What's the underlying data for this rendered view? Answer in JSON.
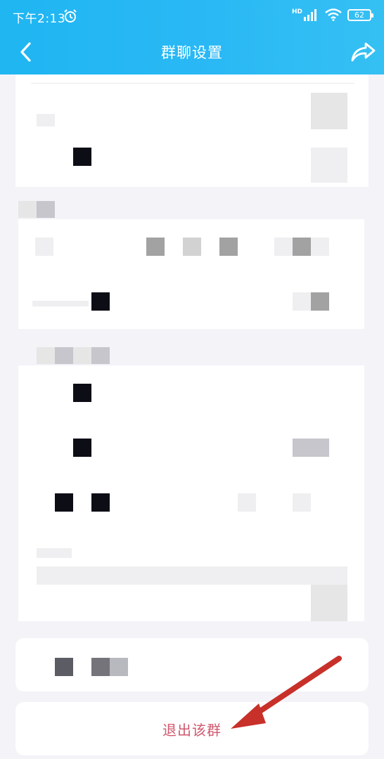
{
  "status_bar": {
    "time": "下午2:13",
    "network": "HD",
    "battery": "62"
  },
  "nav": {
    "title": "群聊设置"
  },
  "actions": {
    "exit_group_label": "退出该群"
  },
  "colors": {
    "header": "#29b8f5",
    "exit_text": "#d0586e",
    "annotation_arrow": "#c8302a"
  },
  "icons": [
    "back-icon",
    "share-icon",
    "alarm-icon",
    "signal-icon",
    "wifi-icon",
    "battery-icon"
  ]
}
